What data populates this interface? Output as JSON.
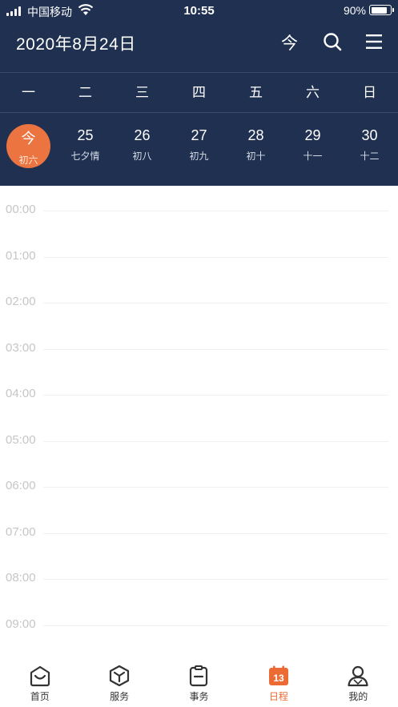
{
  "status_bar": {
    "carrier": "中国移动",
    "time": "10:55",
    "battery_percent": "90%",
    "battery_level": 0.9
  },
  "header": {
    "title": "2020年8月24日",
    "today_button": "今",
    "icons": [
      "search-icon",
      "menu-icon"
    ]
  },
  "weekdays": [
    "一",
    "二",
    "三",
    "四",
    "五",
    "六",
    "日"
  ],
  "week_dates": [
    {
      "day": "今",
      "lunar": "初六",
      "is_today": true
    },
    {
      "day": "25",
      "lunar": "七夕情",
      "is_today": false
    },
    {
      "day": "26",
      "lunar": "初八",
      "is_today": false
    },
    {
      "day": "27",
      "lunar": "初九",
      "is_today": false
    },
    {
      "day": "28",
      "lunar": "初十",
      "is_today": false
    },
    {
      "day": "29",
      "lunar": "十一",
      "is_today": false
    },
    {
      "day": "30",
      "lunar": "十二",
      "is_today": false
    }
  ],
  "timeline": {
    "hours": [
      "00:00",
      "01:00",
      "02:00",
      "03:00",
      "04:00",
      "05:00",
      "06:00",
      "07:00",
      "08:00",
      "09:00"
    ]
  },
  "tab_bar": {
    "tabs": [
      {
        "label": "首页",
        "icon": "home-icon",
        "active": false
      },
      {
        "label": "服务",
        "icon": "cube-icon",
        "active": false
      },
      {
        "label": "事务",
        "icon": "clipboard-icon",
        "active": false
      },
      {
        "label": "日程",
        "icon": "calendar-icon",
        "active": true
      },
      {
        "label": "我的",
        "icon": "profile-icon",
        "active": false
      }
    ],
    "calendar_icon_day": "13"
  },
  "colors": {
    "header_bg": "#1f3050",
    "accent": "#ec7440",
    "tab_active": "#ec6b34"
  }
}
